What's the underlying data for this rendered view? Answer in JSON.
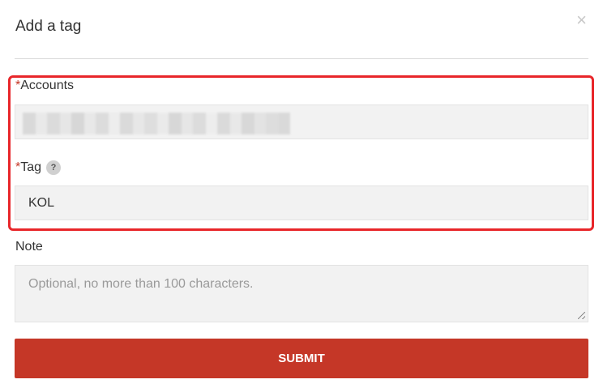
{
  "dialog": {
    "title": "Add a tag",
    "close_icon": "×"
  },
  "accounts": {
    "required_mark": "*",
    "label": "Accounts"
  },
  "tag": {
    "required_mark": "*",
    "label": "Tag",
    "help_icon": "?",
    "value": "KOL"
  },
  "note": {
    "label": "Note",
    "placeholder": "Optional, no more than 100 characters."
  },
  "submit": {
    "label": "SUBMIT"
  },
  "colors": {
    "primary": "#c53727",
    "highlight_border": "#e8262a",
    "field_bg": "#f2f2f2"
  }
}
